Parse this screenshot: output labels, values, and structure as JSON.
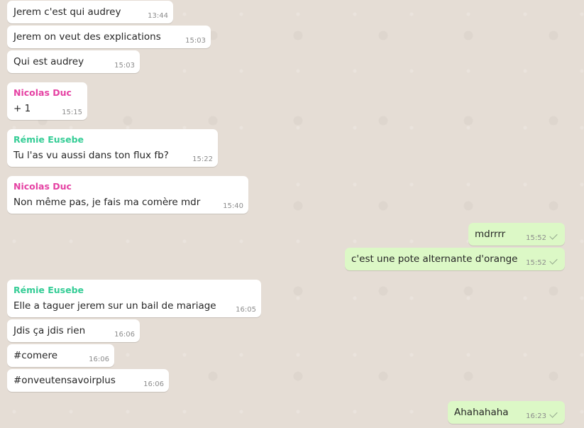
{
  "colors": {
    "nicolas": "#e542a3",
    "remie": "#35cd96"
  },
  "messages": [
    {
      "text": "Jerem c'est qui audrey",
      "time": "13:44"
    },
    {
      "text": "Jerem on veut des explications",
      "time": "15:03"
    },
    {
      "text": "Qui est audrey",
      "time": "15:03"
    },
    {
      "sender": "Nicolas Duc",
      "text": "+ 1",
      "time": "15:15"
    },
    {
      "sender": "Rémie Eusebe",
      "text": "Tu l'as vu aussi dans ton flux fb?",
      "time": "15:22"
    },
    {
      "sender": "Nicolas Duc",
      "text": "Non même pas, je fais ma comère mdr",
      "time": "15:40"
    },
    {
      "text": "mdrrrr",
      "time": "15:52",
      "status_icon": "single-check-icon"
    },
    {
      "text": "c'est une pote alternante d'orange",
      "time": "15:52",
      "status_icon": "single-check-icon"
    },
    {
      "sender": "Rémie Eusebe",
      "text": "Elle a taguer jerem sur un bail de mariage",
      "time": "16:05"
    },
    {
      "text": "Jdis ça jdis rien",
      "time": "16:06"
    },
    {
      "text": "#comere",
      "time": "16:06"
    },
    {
      "text": "#onveutensavoirplus",
      "time": "16:06"
    },
    {
      "text": "Ahahahaha",
      "time": "16:23",
      "status_icon": "single-check-icon"
    }
  ]
}
